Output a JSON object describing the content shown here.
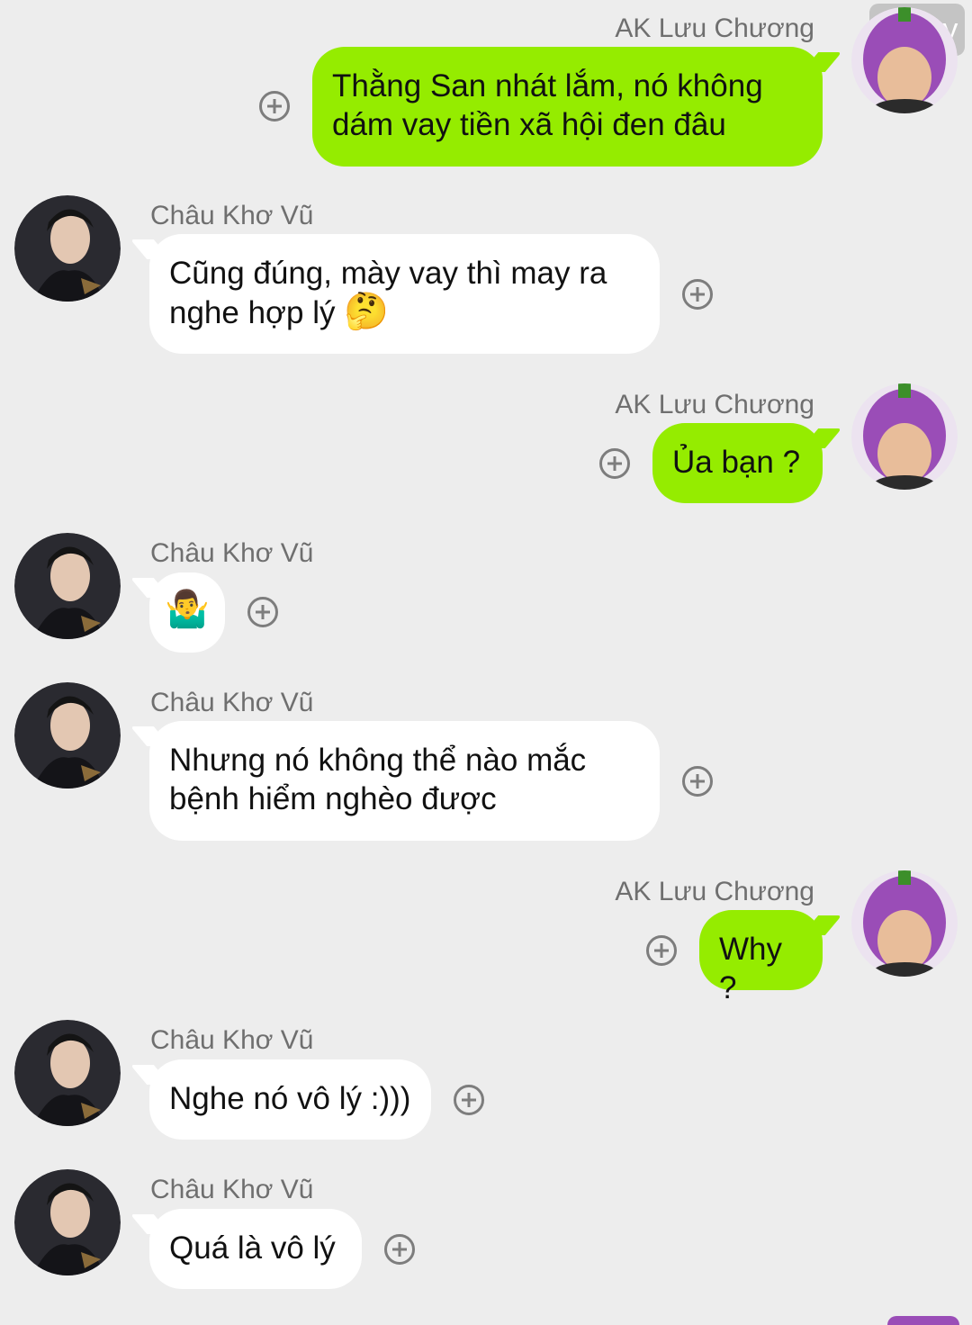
{
  "watermark": "74 joy",
  "contacts": {
    "me": "AK Lưu Chương",
    "them": "Châu Khơ Vũ"
  },
  "messages": [
    {
      "sender": "AK Lưu Chương",
      "lines": [
        "Thằng San nhát lắm, nó không",
        "dám vay tiền xã hội đen đâu"
      ]
    },
    {
      "sender": "Châu Khơ Vũ",
      "lines": [
        "Cũng đúng, mày vay thì may ra",
        "nghe hợp lý"
      ],
      "emoji": "🤔"
    },
    {
      "sender": "AK Lưu Chương",
      "lines": [
        "Ủa bạn ?"
      ]
    },
    {
      "sender": "Châu Khơ Vũ",
      "lines": [],
      "emoji": "🤷‍♂️"
    },
    {
      "sender": "Châu Khơ Vũ",
      "lines": [
        "Nhưng nó không thể nào mắc",
        "bệnh hiểm nghèo được"
      ]
    },
    {
      "sender": "AK Lưu Chương",
      "lines": [
        "Why ?"
      ]
    },
    {
      "sender": "Châu Khơ Vũ",
      "lines": [
        "Nghe nó vô lý :)))"
      ]
    },
    {
      "sender": "Châu Khơ Vũ",
      "lines": [
        "Quá là vô lý"
      ]
    }
  ],
  "colors": {
    "background": "#ededed",
    "my_bubble": "#95ec00",
    "their_bubble": "#ffffff",
    "name_text": "#6f6f6f"
  },
  "icons": {
    "add_reaction": "plus-circle-icon"
  }
}
